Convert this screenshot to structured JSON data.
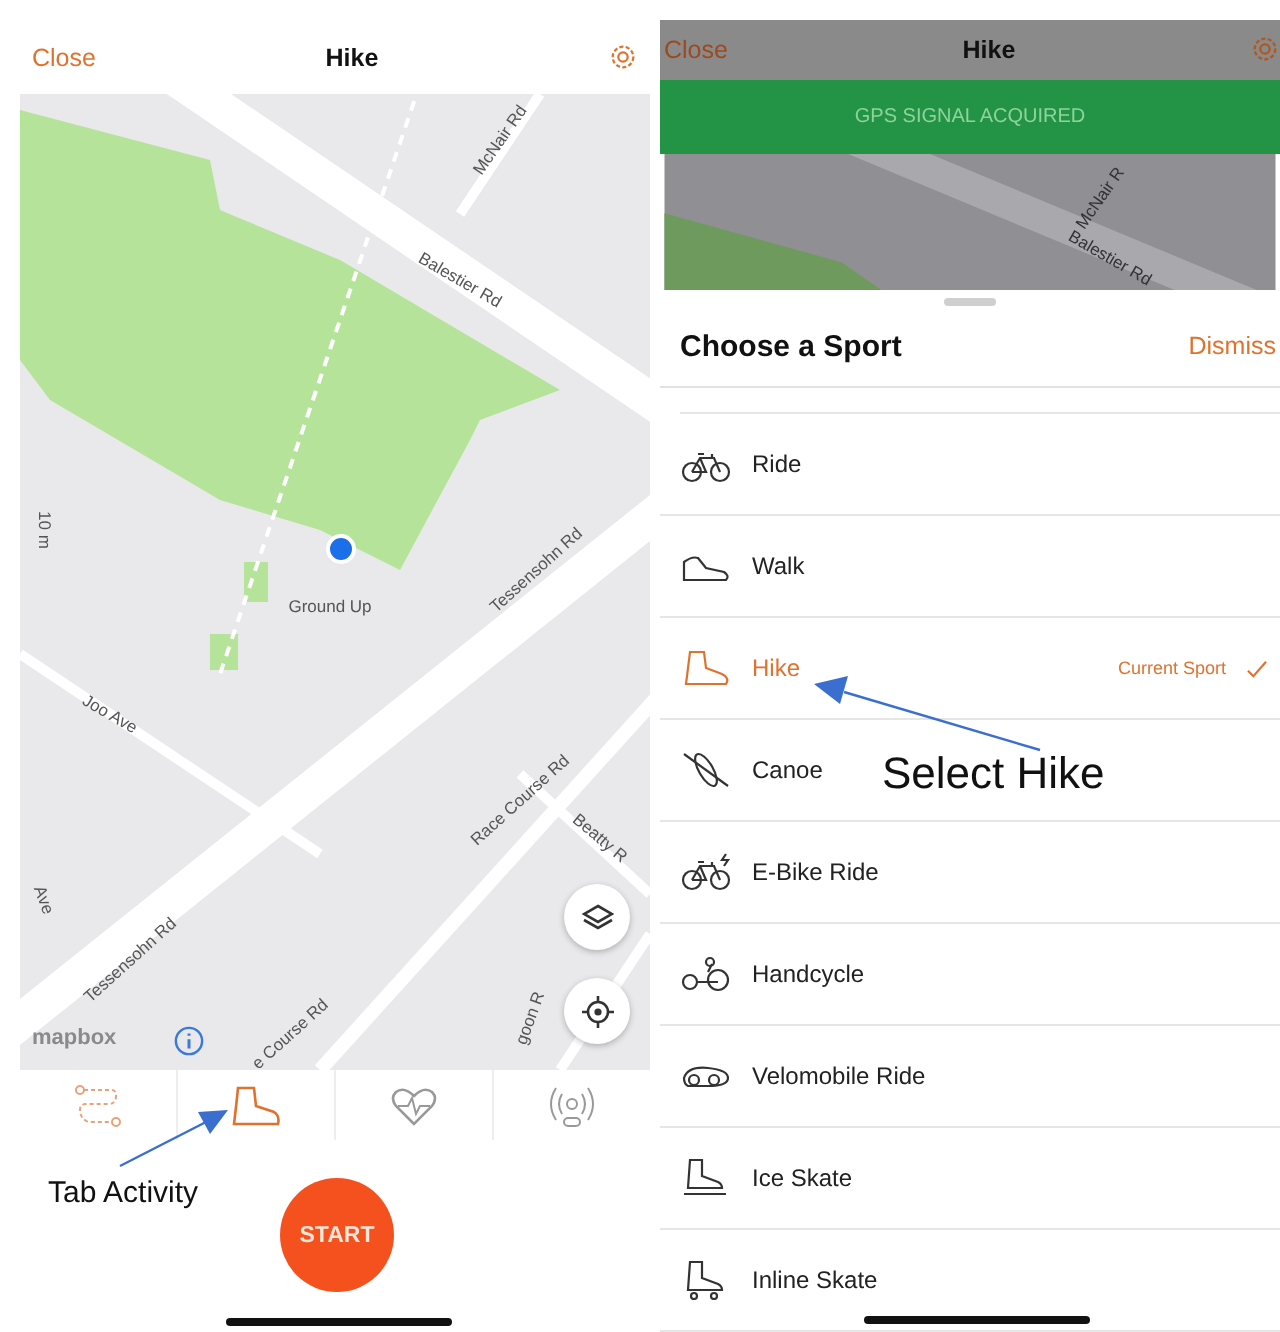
{
  "left_screen": {
    "header": {
      "close": "Close",
      "title": "Hike"
    },
    "map_labels": [
      {
        "text": "McNair Rd"
      },
      {
        "text": "Balestier Rd"
      },
      {
        "text": "Tessensohn Rd"
      },
      {
        "text": "Ground Up"
      },
      {
        "text": "10 m"
      },
      {
        "text": "Joo Ave"
      },
      {
        "text": "Race Course Rd"
      },
      {
        "text": "Beatty R"
      },
      {
        "text": "Tessensohn Rd"
      },
      {
        "text": "e Course Rd"
      },
      {
        "text": "Ave"
      },
      {
        "text": "goon R"
      }
    ],
    "attribution": "mapbox",
    "tabs": [
      {
        "kind": "route",
        "selected": false
      },
      {
        "kind": "boot",
        "selected": true
      },
      {
        "kind": "heart",
        "selected": false
      },
      {
        "kind": "sensor",
        "selected": false
      }
    ],
    "start_button": "START"
  },
  "right_screen": {
    "header": {
      "close": "Close",
      "title": "Hike"
    },
    "banner": "GPS SIGNAL ACQUIRED",
    "map_labels": [
      {
        "text": "McNair R"
      },
      {
        "text": "Balestier Rd"
      }
    ],
    "sheet": {
      "title": "Choose a Sport",
      "dismiss": "Dismiss",
      "current_label": "Current Sport",
      "sports": [
        {
          "name": "Ride",
          "kind": "bike",
          "selected": false
        },
        {
          "name": "Walk",
          "kind": "shoe",
          "selected": false
        },
        {
          "name": "Hike",
          "kind": "boot",
          "selected": true
        },
        {
          "name": "Canoe",
          "kind": "kayak",
          "selected": false
        },
        {
          "name": "E-Bike Ride",
          "kind": "ebike",
          "selected": false
        },
        {
          "name": "Handcycle",
          "kind": "handcycle",
          "selected": false
        },
        {
          "name": "Velomobile Ride",
          "kind": "velomobile",
          "selected": false
        },
        {
          "name": "Ice Skate",
          "kind": "skate",
          "selected": false
        },
        {
          "name": "Inline Skate",
          "kind": "inline",
          "selected": false
        }
      ]
    }
  },
  "annotations": [
    {
      "text": "Tab Activity"
    },
    {
      "text": "Select Hike"
    }
  ]
}
